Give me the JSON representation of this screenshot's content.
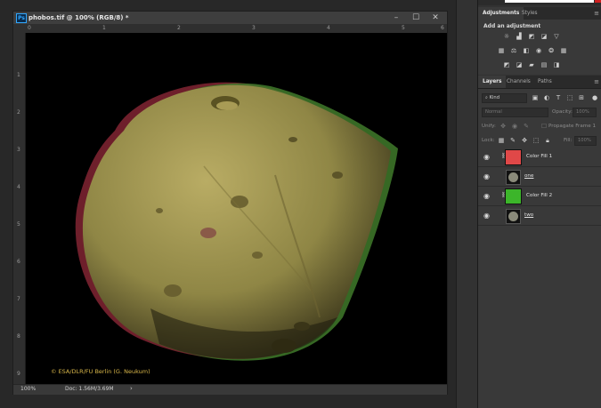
{
  "document": {
    "title": "phobos.tif @ 100% (RGB/8) *",
    "app_badge": "Ps",
    "window_buttons": [
      "–",
      "☐",
      "✕"
    ],
    "ruler_top": [
      "0",
      "1",
      "2",
      "3",
      "4",
      "5",
      "6"
    ],
    "ruler_left": [
      "1",
      "2",
      "3",
      "4",
      "5",
      "6",
      "7",
      "8",
      "9"
    ],
    "image_credit": "© ESA/DLR/FU Berlin (G. Neukum)",
    "status": {
      "zoom": "100%",
      "doc_size": "Doc: 1.56M/3.69M",
      "arrow": "›"
    }
  },
  "adjustments_panel": {
    "tabs": [
      "Adjustments",
      "Styles"
    ],
    "add_label": "Add an adjustment",
    "row1_icons": [
      "brightness-contrast-icon",
      "levels-icon",
      "curves-icon",
      "exposure-icon",
      "vibrance-triangle-icon"
    ],
    "row2_icons": [
      "hue-saturation-icon",
      "color-balance-icon",
      "black-white-icon",
      "photo-filter-icon",
      "channel-mixer-icon",
      "color-lookup-icon"
    ],
    "row3_icons": [
      "invert-icon",
      "posterize-icon",
      "threshold-icon",
      "gradient-map-icon",
      "selective-color-icon"
    ]
  },
  "layers_panel": {
    "tabs": [
      "Layers",
      "Channels",
      "Paths"
    ],
    "filter_kind": "Kind",
    "blend_mode": "Normal",
    "opacity_label": "Opacity:",
    "opacity_value": "100%",
    "unify_label": "Unify:",
    "propagate_label": "Propagate Frame 1",
    "lock_label": "Lock:",
    "fill_label": "Fill:",
    "fill_value": "100%",
    "layers": [
      {
        "name": "Color Fill 1",
        "type": "fill",
        "color": "#e04848",
        "linked": true,
        "underline": false
      },
      {
        "name": "one",
        "type": "image",
        "linked": false,
        "underline": true
      },
      {
        "name": "Color Fill 2",
        "type": "fill",
        "color": "#3cb52a",
        "linked": true,
        "underline": false
      },
      {
        "name": "two",
        "type": "image",
        "linked": false,
        "underline": true
      }
    ]
  },
  "colors": {
    "accent": "#31a8ff",
    "fill_red": "#e04848",
    "fill_green": "#3cb52a",
    "credit": "#d9b74a"
  }
}
